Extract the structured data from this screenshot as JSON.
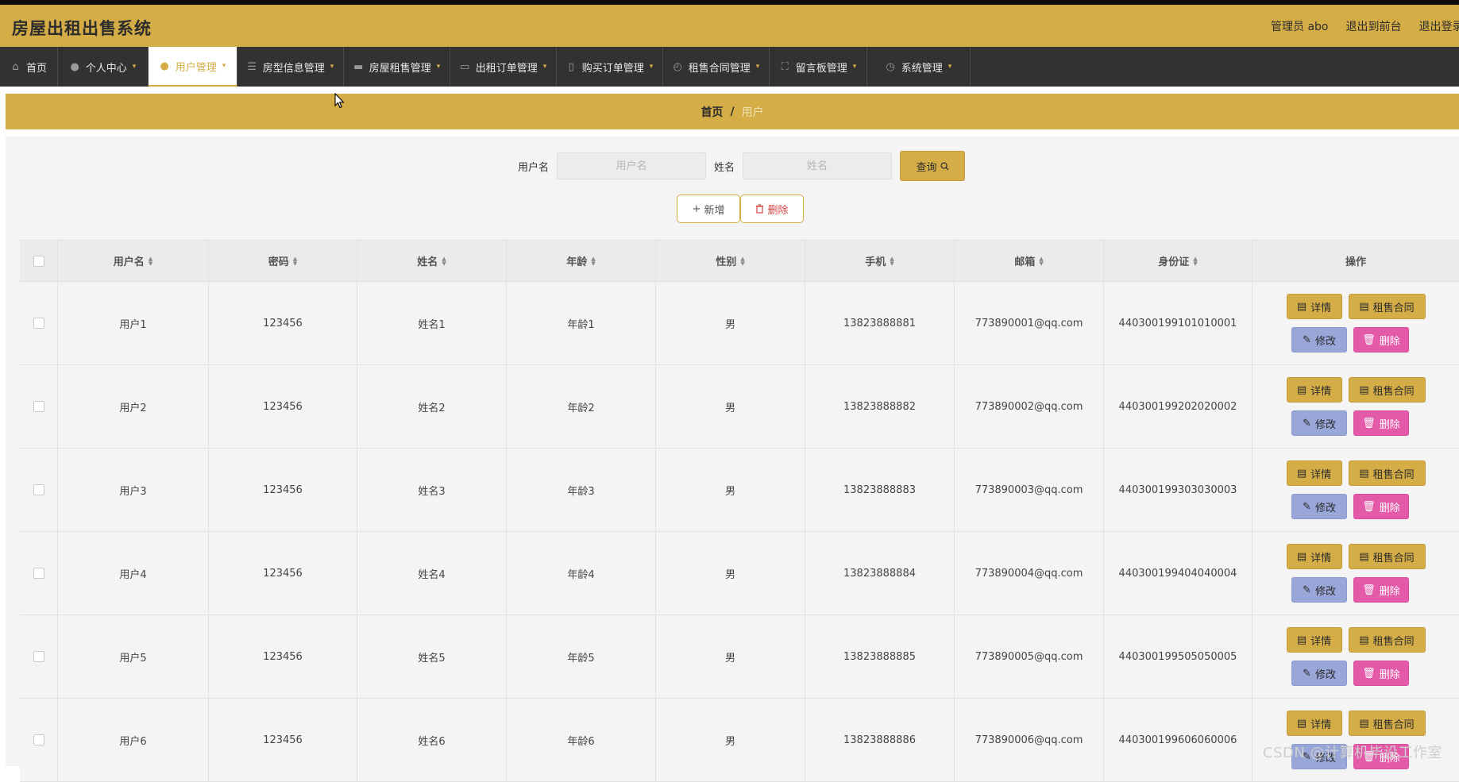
{
  "app": {
    "title": "房屋出租出售系统"
  },
  "header": {
    "user_label": "管理员 abo",
    "front_link": "退出到前台",
    "logout_link": "退出登录"
  },
  "nav": [
    {
      "label": "首页",
      "icon": "home-icon",
      "active": false
    },
    {
      "label": "个人中心",
      "icon": "person-icon",
      "active": false
    },
    {
      "label": "用户管理",
      "icon": "user-icon",
      "active": true
    },
    {
      "label": "房型信息管理",
      "icon": "list-icon",
      "active": false
    },
    {
      "label": "房屋租售管理",
      "icon": "chat-icon",
      "active": false
    },
    {
      "label": "出租订单管理",
      "icon": "message-icon",
      "active": false
    },
    {
      "label": "购买订单管理",
      "icon": "phone-icon",
      "active": false
    },
    {
      "label": "租售合同管理",
      "icon": "clock-icon",
      "active": false
    },
    {
      "label": "留言板管理",
      "icon": "fullscreen-icon",
      "active": false
    },
    {
      "label": "系统管理",
      "icon": "time-icon",
      "active": false
    }
  ],
  "breadcrumb": {
    "home": "首页",
    "sep": "/",
    "current": "用户"
  },
  "search": {
    "username_label": "用户名",
    "username_placeholder": "用户名",
    "name_label": "姓名",
    "name_placeholder": "姓名",
    "query_button": "查询"
  },
  "actions": {
    "add": "新增",
    "delete": "删除"
  },
  "table": {
    "columns": [
      "用户名",
      "密码",
      "姓名",
      "年龄",
      "性别",
      "手机",
      "邮箱",
      "身份证",
      "操作"
    ],
    "rows": [
      [
        "用户1",
        "123456",
        "姓名1",
        "年龄1",
        "男",
        "13823888881",
        "773890001@qq.com",
        "440300199101010001"
      ],
      [
        "用户2",
        "123456",
        "姓名2",
        "年龄2",
        "男",
        "13823888882",
        "773890002@qq.com",
        "440300199202020002"
      ],
      [
        "用户3",
        "123456",
        "姓名3",
        "年龄3",
        "男",
        "13823888883",
        "773890003@qq.com",
        "440300199303030003"
      ],
      [
        "用户4",
        "123456",
        "姓名4",
        "年龄4",
        "男",
        "13823888884",
        "773890004@qq.com",
        "440300199404040004"
      ],
      [
        "用户5",
        "123456",
        "姓名5",
        "年龄5",
        "男",
        "13823888885",
        "773890005@qq.com",
        "440300199505050005"
      ],
      [
        "用户6",
        "123456",
        "姓名6",
        "年龄6",
        "男",
        "13823888886",
        "773890006@qq.com",
        "440300199606060006"
      ]
    ],
    "ops": {
      "detail": "详情",
      "contract": "租售合同",
      "edit": "修改",
      "delete": "删除"
    }
  },
  "watermark": "CSDN @计算机毕设工作室",
  "colors": {
    "accent": "#d4ad47",
    "nav_bg": "#323232",
    "edit": "#98a6d8",
    "danger": "#e35aa8"
  }
}
